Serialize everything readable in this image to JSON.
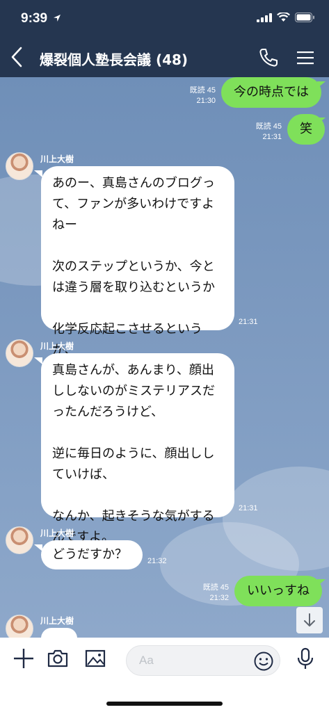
{
  "status_bar": {
    "time": "9:39"
  },
  "header": {
    "title": "爆裂個人塾長会議 (48)"
  },
  "messages": [
    {
      "side": "right",
      "text": "今の時点では",
      "read": "既読 45",
      "time": "21:30"
    },
    {
      "side": "right",
      "text": "笑",
      "read": "既読 45",
      "time": "21:31"
    },
    {
      "side": "left",
      "sender": "川上大樹",
      "text": "あのー、真島さんのブログっ\nて、ファンが多いわけですよ\nねー\n\n次のステップというか、今と\nは違う層を取り込むというか\n\n化学反応起こさせるという\nか、",
      "time": "21:31"
    },
    {
      "side": "left",
      "sender": "川上大樹",
      "text": "真島さんが、あんまり、顔出\nししないのがミステリアスだ\nったんだろうけど、\n\n逆に毎日のように、顔出しし\nていけば、\n\nなんか、起きそうな気がする\nんですよ。",
      "time": "21:31"
    },
    {
      "side": "left",
      "sender": "川上大樹",
      "text": "どうだすか？",
      "time": "21:32"
    },
    {
      "side": "right",
      "text": "いいっすね",
      "read": "既読 45",
      "time": "21:32"
    },
    {
      "side": "left",
      "sender": "川上大樹",
      "text": ""
    }
  ],
  "input": {
    "placeholder": "Aa"
  },
  "colors": {
    "header": "#253650",
    "sent_bubble": "#7fe05a",
    "received_bubble": "#ffffff",
    "chat_bg": "#7d9ac0"
  },
  "icons": [
    "location-arrow-icon",
    "signal-icon",
    "wifi-icon",
    "battery-icon",
    "back-chevron-icon",
    "phone-icon",
    "menu-icon",
    "arrow-down-icon",
    "plus-icon",
    "camera-icon",
    "image-icon",
    "emoji-icon",
    "microphone-icon"
  ]
}
